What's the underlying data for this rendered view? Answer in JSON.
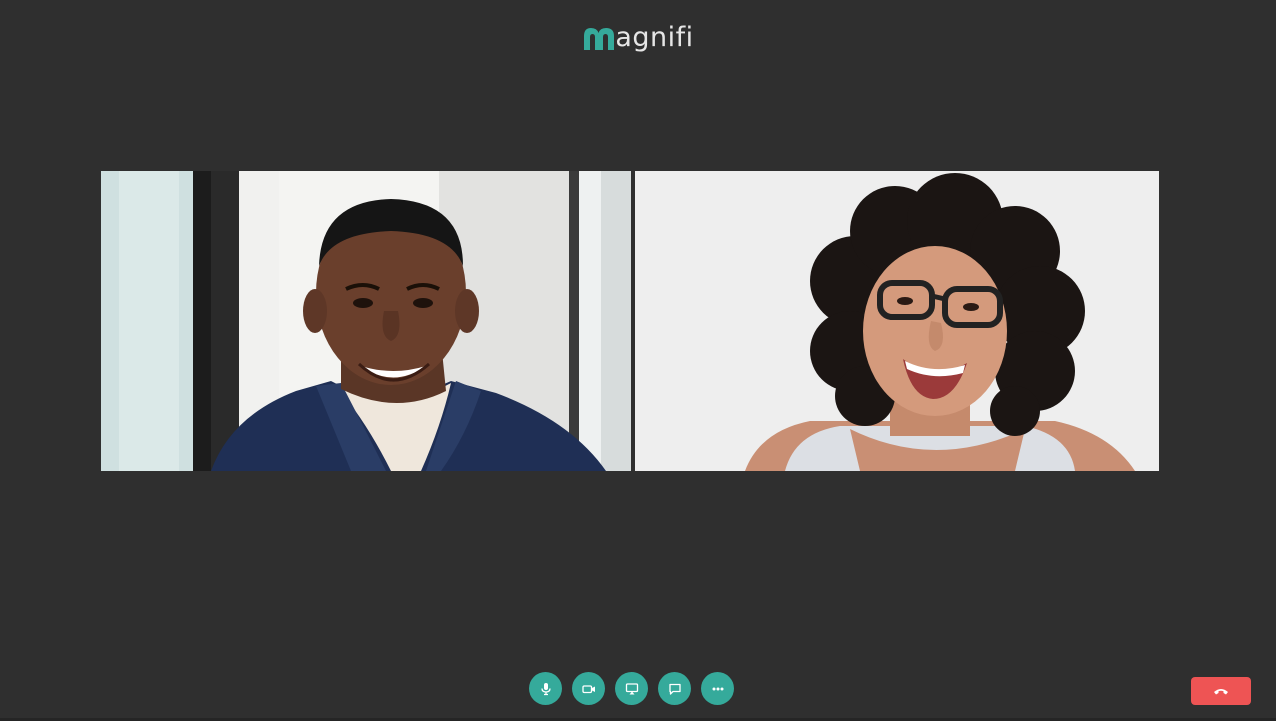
{
  "brand": {
    "name": "magnifi",
    "logo_letter": "m",
    "logo_rest": "agnifi",
    "accent_color": "#35aa9b"
  },
  "participants": [
    {
      "id": "participant-1",
      "avatar_desc": "man-smiling-video-feed"
    },
    {
      "id": "participant-2",
      "avatar_desc": "woman-laughing-video-feed"
    }
  ],
  "controls": [
    {
      "name": "microphone-button",
      "icon": "microphone-icon"
    },
    {
      "name": "camera-button",
      "icon": "video-camera-icon"
    },
    {
      "name": "screen-share-button",
      "icon": "screen-share-icon"
    },
    {
      "name": "chat-button",
      "icon": "chat-bubble-icon"
    },
    {
      "name": "more-options-button",
      "icon": "more-dots-icon"
    }
  ],
  "hangup": {
    "icon": "phone-hangup-icon",
    "color": "#ee5454"
  }
}
